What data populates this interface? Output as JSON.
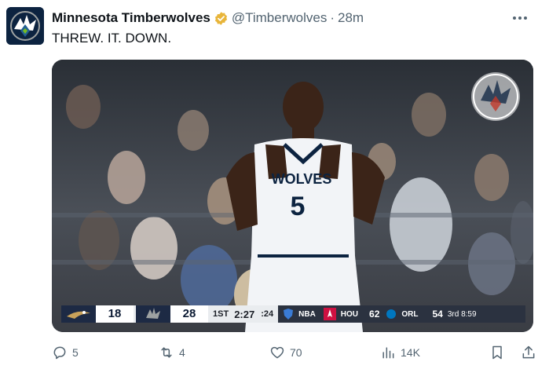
{
  "tweet": {
    "author_name": "Minnesota Timberwolves",
    "handle": "@Timberwolves",
    "separator": "·",
    "time": "28m",
    "text": "THREW. IT. DOWN.",
    "verified_color": "#e8b53a"
  },
  "media": {
    "jersey_text": "WOLVES",
    "jersey_number": "5",
    "scorebug": {
      "away_score": "18",
      "home_score": "28",
      "quarter": "1ST",
      "clock": "2:27",
      "shot_clock": ":24",
      "network": "NBA",
      "other_team_a": "HOU",
      "other_score_a": "62",
      "other_team_b": "ORL",
      "other_score_b": "54",
      "other_period": "3rd 8:59"
    }
  },
  "actions": {
    "replies": "5",
    "retweets": "4",
    "likes": "70",
    "views": "14K"
  },
  "colors": {
    "text_primary": "#0f1419",
    "text_secondary": "#536471",
    "brand_navy": "#0c2340"
  }
}
